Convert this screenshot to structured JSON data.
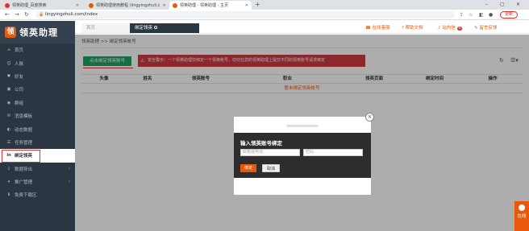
{
  "browser": {
    "tabs": [
      {
        "title": "领英助理_百度搜索",
        "fav_color": "#e03131",
        "active": false
      },
      {
        "title": "领英助理使用教程 (lingyingzhuli.c",
        "fav_color": "#e8590c",
        "active": false
      },
      {
        "title": "领英助理 - 领英助理 - 主页",
        "fav_color": "#e8590c",
        "active": true
      }
    ],
    "url": "lingyingzhuli.com/index",
    "update_label": "更新"
  },
  "sidebar": {
    "logo_text": "领英助理",
    "items": [
      {
        "label": "首页",
        "icon": "home-icon",
        "glyph": "⌂",
        "has_arrow": false,
        "active": false
      },
      {
        "label": "人脉",
        "icon": "people-icon",
        "glyph": "☺",
        "has_arrow": false,
        "active": false
      },
      {
        "label": "好友",
        "icon": "friend-icon",
        "glyph": "♥",
        "has_arrow": false,
        "active": false
      },
      {
        "label": "公司",
        "icon": "company-icon",
        "glyph": "▣",
        "has_arrow": false,
        "active": false
      },
      {
        "label": "群组",
        "icon": "group-icon",
        "glyph": "◉",
        "has_arrow": false,
        "active": false
      },
      {
        "label": "消息模板",
        "icon": "message-icon",
        "glyph": "✉",
        "has_arrow": false,
        "active": false
      },
      {
        "label": "动态数据",
        "icon": "data-icon",
        "glyph": "◐",
        "has_arrow": false,
        "active": false
      },
      {
        "label": "任务管理",
        "icon": "task-icon",
        "glyph": "☰",
        "has_arrow": false,
        "active": false
      },
      {
        "label": "绑定领英",
        "icon": "linkedin-icon",
        "glyph": "in",
        "has_arrow": false,
        "active": true
      },
      {
        "label": "数据导出",
        "icon": "export-icon",
        "glyph": "⇩",
        "has_arrow": true,
        "active": false
      },
      {
        "label": "推广管理",
        "icon": "promo-icon",
        "glyph": "✦",
        "has_arrow": true,
        "active": false
      },
      {
        "label": "免费下载区",
        "icon": "download-icon",
        "glyph": "⬇",
        "has_arrow": false,
        "active": false
      }
    ]
  },
  "topbar": {
    "tabs": [
      {
        "label": "首页",
        "active": false
      },
      {
        "label": "绑定领英 ✪",
        "active": true
      }
    ],
    "links": {
      "service": "在线客服",
      "help": "帮助文档",
      "inbox": "站内信",
      "inbox_count": "0",
      "feedback": "留言反馈"
    }
  },
  "content": {
    "breadcrumb": "领英助理  >>  绑定领英帐号",
    "bind_button": "点击绑定领英账号",
    "alert": "安全警示：一个领英助理仅绑定一个领英帐号，切勿在您的领英助理上提交不同的领英账号请求绑定",
    "table": {
      "headers": [
        "头像",
        "姓名",
        "领英账号",
        "职业",
        "领英页面",
        "绑定时间",
        "操作"
      ],
      "empty_text": "暂未绑定领英帐号"
    }
  },
  "modal": {
    "title": "输入领英账号绑定",
    "email_placeholder": "邮箱或电话",
    "password_placeholder": "密码",
    "ok_label": "绑定",
    "cancel_label": "取消"
  },
  "widget": {
    "label": "在线"
  },
  "colors": {
    "sidebar_bg": "#2b3643",
    "accent": "#e8590c",
    "alert_bg": "#cf3a45",
    "bind_green": "#21a366"
  }
}
